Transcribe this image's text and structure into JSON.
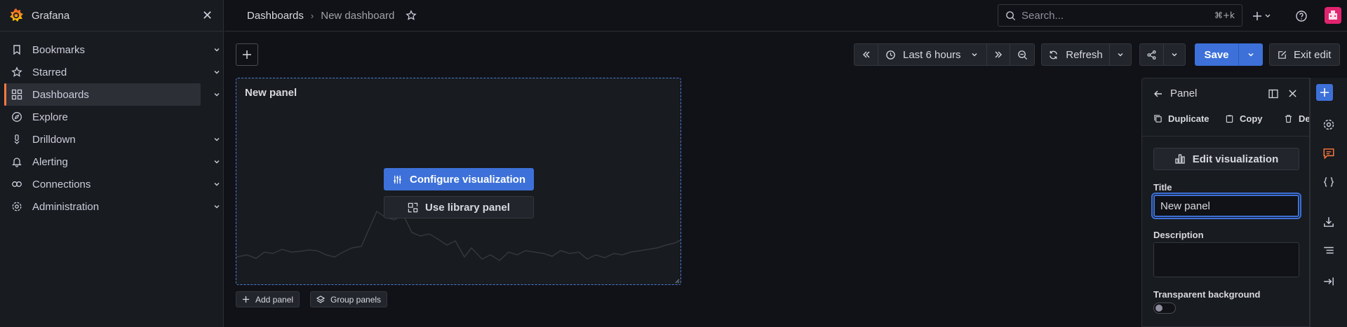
{
  "app": {
    "title": "Grafana"
  },
  "sidebar": {
    "items": [
      {
        "label": "Bookmarks",
        "icon": "bookmark-icon",
        "expandable": true
      },
      {
        "label": "Starred",
        "icon": "star-icon",
        "expandable": true
      },
      {
        "label": "Dashboards",
        "icon": "apps-icon",
        "expandable": true,
        "active": true
      },
      {
        "label": "Explore",
        "icon": "compass-icon",
        "expandable": false
      },
      {
        "label": "Drilldown",
        "icon": "drilldown-icon",
        "expandable": true
      },
      {
        "label": "Alerting",
        "icon": "bell-icon",
        "expandable": true
      },
      {
        "label": "Connections",
        "icon": "connections-icon",
        "expandable": true
      },
      {
        "label": "Administration",
        "icon": "cog-icon",
        "expandable": true
      }
    ]
  },
  "breadcrumb": {
    "root": "Dashboards",
    "current": "New dashboard",
    "separator": "›"
  },
  "search": {
    "placeholder": "Search...",
    "shortcut": "⌘+k"
  },
  "toolbar": {
    "time_range": "Last 6 hours",
    "refresh_label": "Refresh",
    "save_label": "Save",
    "exit_label": "Exit edit"
  },
  "panel": {
    "title": "New panel",
    "configure_label": "Configure visualization",
    "library_label": "Use library panel"
  },
  "bottom_actions": {
    "add_panel": "Add panel",
    "group_panels": "Group panels"
  },
  "right_pane": {
    "title": "Panel",
    "actions": {
      "duplicate": "Duplicate",
      "copy": "Copy",
      "delete": "De"
    },
    "edit_visualization": "Edit visualization",
    "title_label": "Title",
    "title_value": "New panel",
    "description_label": "Description",
    "description_value": "",
    "transparent_label": "Transparent background",
    "transparent_enabled": false
  },
  "colors": {
    "primary": "#3d71d9",
    "accent": "#ff7941",
    "avatar": "#e0246f",
    "comment_icon": "#ff7941"
  }
}
